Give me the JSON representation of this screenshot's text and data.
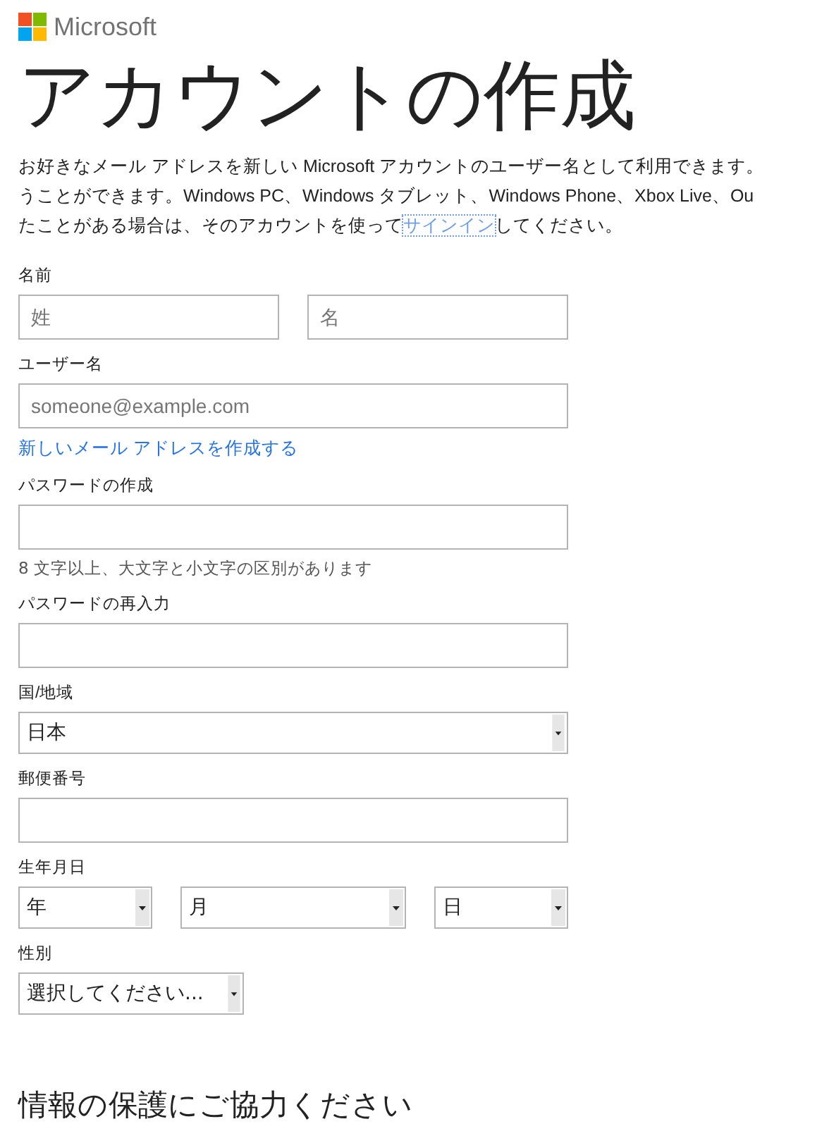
{
  "logo": {
    "text": "Microsoft"
  },
  "title": "アカウントの作成",
  "intro": {
    "lines": [
      "お好きなメール アドレスを新しい Microsoft アカウントのユーザー名として利用できます。",
      "うことができます。Windows PC、Windows タブレット、Windows Phone、Xbox Live、Ou",
      "たことがある場合は、そのアカウントを使って"
    ],
    "link": "サインイン",
    "after": "してください。"
  },
  "fields": [
    {
      "label": "名前",
      "kind": "pair",
      "inputs": [
        {
          "placeholder": "姓"
        },
        {
          "placeholder": "名"
        }
      ]
    },
    {
      "label": "ユーザー名",
      "kind": "text",
      "placeholder": "someone@example.com",
      "link": "新しいメール アドレスを作成する"
    },
    {
      "label": "パスワードの作成",
      "kind": "text",
      "hint": "8 文字以上、大文字と小文字の区別があります"
    },
    {
      "label": "パスワードの再入力",
      "kind": "text"
    },
    {
      "label": "国/地域",
      "kind": "select",
      "value": "日本"
    },
    {
      "label": "郵便番号",
      "kind": "text"
    },
    {
      "label": "生年月日",
      "kind": "date",
      "selects": [
        "年",
        "月",
        "日"
      ]
    },
    {
      "label": "性別",
      "kind": "short-select",
      "value": "選択してください..."
    }
  ],
  "section_heading": "情報の保護にご協力ください"
}
